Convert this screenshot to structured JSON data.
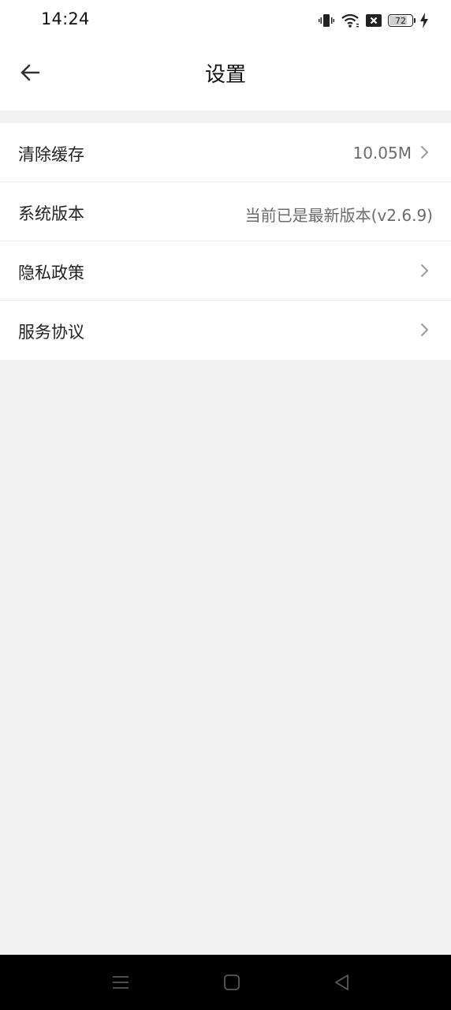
{
  "status_bar": {
    "time": "14:24",
    "battery_level": "72",
    "icons": [
      "vibrate-icon",
      "wifi-icon",
      "no-sim-icon",
      "battery-icon",
      "charging-icon"
    ]
  },
  "header": {
    "title": "设置",
    "back_icon": "arrow-left-icon"
  },
  "settings": [
    {
      "label": "清除缓存",
      "value": "10.05M",
      "chevron": true
    },
    {
      "label": "系统版本",
      "value": "当前已是最新版本(v2.6.9)",
      "chevron": false
    },
    {
      "label": "隐私政策",
      "value": "",
      "chevron": true
    },
    {
      "label": "服务协议",
      "value": "",
      "chevron": true
    }
  ],
  "nav_bar": {
    "icons": [
      "menu-icon",
      "home-icon",
      "back-triangle-icon"
    ]
  },
  "colors": {
    "page_background": "#f1f1f1",
    "surface": "#ffffff",
    "value_text": "#6b6b6b",
    "nav_bar": "#000000"
  }
}
